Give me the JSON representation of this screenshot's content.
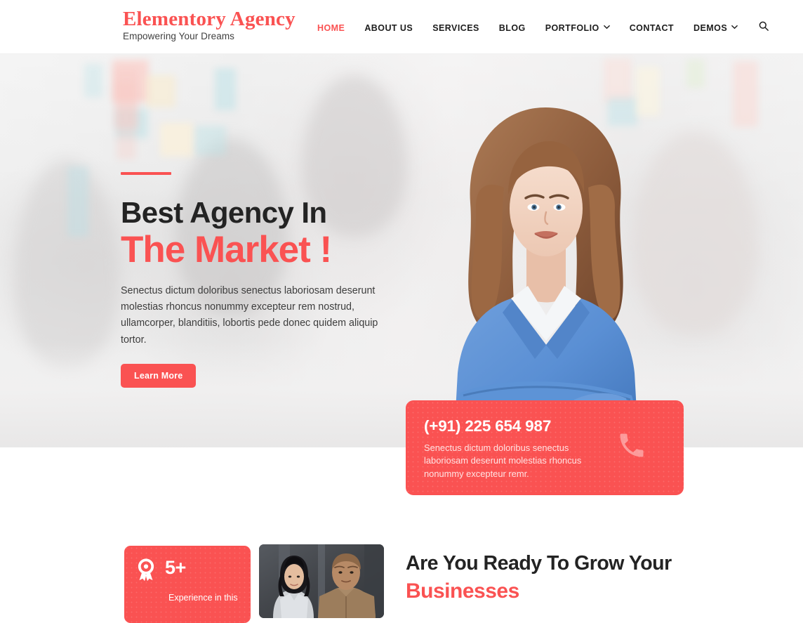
{
  "header": {
    "brand_name": "Elementory Agency",
    "brand_tagline": "Empowering Your Dreams",
    "nav": [
      {
        "label": "HOME",
        "active": true,
        "caret": false
      },
      {
        "label": "ABOUT US",
        "active": false,
        "caret": false
      },
      {
        "label": "SERVICES",
        "active": false,
        "caret": false
      },
      {
        "label": "BLOG",
        "active": false,
        "caret": false
      },
      {
        "label": "PORTFOLIO",
        "active": false,
        "caret": true
      },
      {
        "label": "CONTACT",
        "active": false,
        "caret": false
      },
      {
        "label": "DEMOS",
        "active": false,
        "caret": true
      }
    ],
    "search_icon": "search-icon"
  },
  "hero": {
    "title_line1": "Best Agency In",
    "title_line2": "The Market !",
    "paragraph": "Senectus dictum doloribus senectus laboriosam deserunt molestias rhoncus nonummy excepteur rem nostrud, ullamcorper, blanditiis, lobortis pede donec quidem aliquip tortor.",
    "button_label": "Learn More"
  },
  "phone_card": {
    "number": "(+91) 225 654 987",
    "text": "Senectus dictum doloribus senectus laboriosam deserunt molestias rhoncus nonummy excepteur remr.",
    "icon": "phone-icon"
  },
  "bottom": {
    "experience_number": "5+",
    "experience_label": "Experience in this",
    "experience_icon": "award-ribbon-icon",
    "heading_line1": "Are You Ready To Grow Your",
    "heading_line2": "Businesses"
  },
  "colors": {
    "accent": "#fa5252",
    "heading": "#232323",
    "body_text": "#3d3d3d",
    "hero_bg": "#e8e8e8"
  }
}
